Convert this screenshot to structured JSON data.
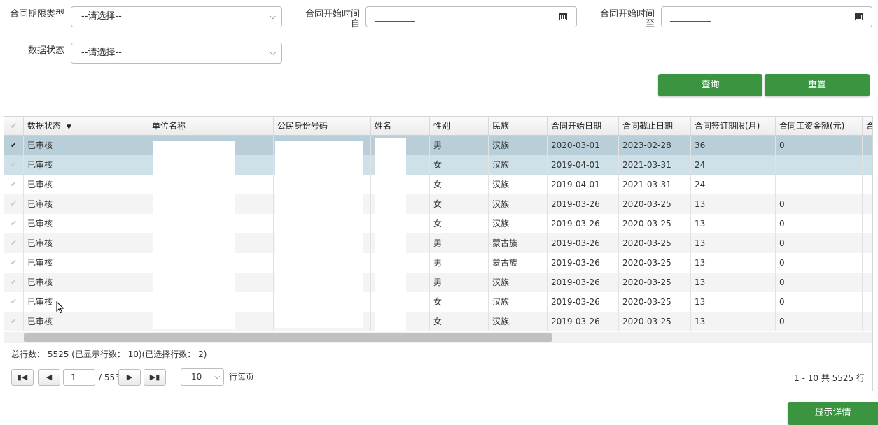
{
  "filters": {
    "period_type": {
      "label": "合同期限类型",
      "value": "--请选择--"
    },
    "start_from": {
      "label_line1": "合同开始时间",
      "label_line2": "自"
    },
    "start_to": {
      "label_line1": "合同开始时间",
      "label_line2": "至"
    },
    "data_status": {
      "label": "数据状态",
      "value": "--请选择--"
    }
  },
  "buttons": {
    "query": "查询",
    "reset": "重置",
    "details": "显示详情"
  },
  "table": {
    "columns": [
      "数据状态",
      "单位名称",
      "公民身份号码",
      "姓名",
      "性别",
      "民族",
      "合同开始日期",
      "合同截止日期",
      "合同签订期限(月)",
      "合同工资金额(元)",
      "合"
    ],
    "sort_indicator": "▼",
    "rows": [
      {
        "status": "已审核",
        "gender": "男",
        "ethnic": "汉族",
        "start": "2020-03-01",
        "end": "2023-02-28",
        "months": "36",
        "salary": "0",
        "selected": true
      },
      {
        "status": "已审核",
        "gender": "女",
        "ethnic": "汉族",
        "start": "2019-04-01",
        "end": "2021-03-31",
        "months": "24",
        "salary": "",
        "selected": true
      },
      {
        "status": "已审核",
        "gender": "女",
        "ethnic": "汉族",
        "start": "2019-04-01",
        "end": "2021-03-31",
        "months": "24",
        "salary": "",
        "selected": false
      },
      {
        "status": "已审核",
        "gender": "女",
        "ethnic": "汉族",
        "start": "2019-03-26",
        "end": "2020-03-25",
        "months": "13",
        "salary": "0",
        "selected": false
      },
      {
        "status": "已审核",
        "gender": "女",
        "ethnic": "汉族",
        "start": "2019-03-26",
        "end": "2020-03-25",
        "months": "13",
        "salary": "0",
        "selected": false
      },
      {
        "status": "已审核",
        "gender": "男",
        "ethnic": "蒙古族",
        "start": "2019-03-26",
        "end": "2020-03-25",
        "months": "13",
        "salary": "0",
        "selected": false
      },
      {
        "status": "已审核",
        "gender": "男",
        "ethnic": "蒙古族",
        "start": "2019-03-26",
        "end": "2020-03-25",
        "months": "13",
        "salary": "0",
        "selected": false
      },
      {
        "status": "已审核",
        "gender": "男",
        "ethnic": "汉族",
        "start": "2019-03-26",
        "end": "2020-03-25",
        "months": "13",
        "salary": "0",
        "selected": false
      },
      {
        "status": "已审核",
        "gender": "女",
        "ethnic": "汉族",
        "start": "2019-03-26",
        "end": "2020-03-25",
        "months": "13",
        "salary": "0",
        "selected": false
      },
      {
        "status": "已审核",
        "gender": "女",
        "ethnic": "汉族",
        "start": "2019-03-26",
        "end": "2020-03-25",
        "months": "13",
        "salary": "0",
        "selected": false
      }
    ]
  },
  "footer": {
    "summary": "总行数： 5525 (已显示行数： 10)(已选择行数： 2)",
    "page_input": "1",
    "page_total": "/ 553",
    "page_size": "10",
    "page_size_label": "行每页",
    "range_text": "1 - 10 共 5525 行"
  },
  "colors": {
    "accent": "#3a9440",
    "row_selected": "#cfe1e8",
    "row_selected_active": "#b8cfd9",
    "row_alt": "#f4f4f4"
  }
}
